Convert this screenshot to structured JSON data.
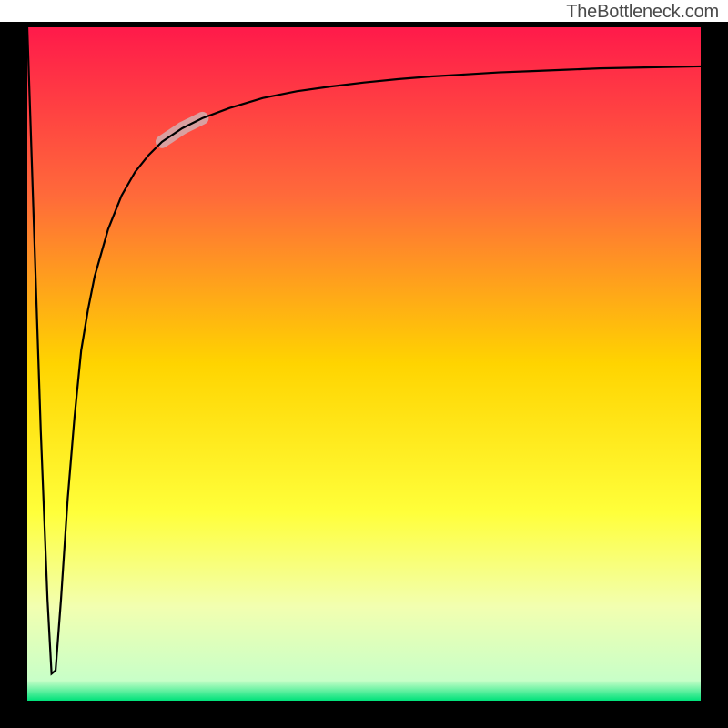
{
  "attribution": "TheBottleneck.com",
  "chart_data": {
    "type": "line",
    "title": "",
    "xlabel": "",
    "ylabel": "",
    "xlim": [
      0,
      100
    ],
    "ylim": [
      0,
      100
    ],
    "grid": false,
    "legend": false,
    "background_gradient": {
      "stops": [
        {
          "pos": 0.0,
          "color": "#ff1a4a"
        },
        {
          "pos": 0.25,
          "color": "#ff6a3a"
        },
        {
          "pos": 0.5,
          "color": "#ffd400"
        },
        {
          "pos": 0.72,
          "color": "#ffff3a"
        },
        {
          "pos": 0.86,
          "color": "#f2ffb0"
        },
        {
          "pos": 0.97,
          "color": "#c8ffc8"
        },
        {
          "pos": 1.0,
          "color": "#00e27a"
        }
      ]
    },
    "series": [
      {
        "name": "bottleneck-curve",
        "x": [
          0.0,
          1.0,
          2.0,
          3.0,
          3.6,
          4.2,
          5.0,
          6.0,
          7.0,
          8.0,
          9.0,
          10.0,
          12.0,
          14.0,
          16.0,
          18.0,
          20.0,
          23.0,
          26.0,
          30.0,
          35.0,
          40.0,
          45.0,
          50.0,
          55.0,
          60.0,
          65.0,
          70.0,
          75.0,
          80.0,
          85.0,
          90.0,
          95.0,
          100.0
        ],
        "y": [
          100.0,
          70.0,
          40.0,
          15.0,
          4.0,
          4.5,
          15.0,
          30.0,
          42.0,
          52.0,
          58.0,
          63.0,
          70.0,
          75.0,
          78.5,
          81.0,
          83.0,
          85.0,
          86.5,
          88.0,
          89.5,
          90.5,
          91.2,
          91.8,
          92.3,
          92.7,
          93.0,
          93.3,
          93.5,
          93.7,
          93.9,
          94.0,
          94.1,
          94.2
        ]
      }
    ],
    "highlight_segment": {
      "series": "bottleneck-curve",
      "x_start": 20.0,
      "x_end": 26.0,
      "color": "#d9a0a0",
      "width": 14
    }
  }
}
